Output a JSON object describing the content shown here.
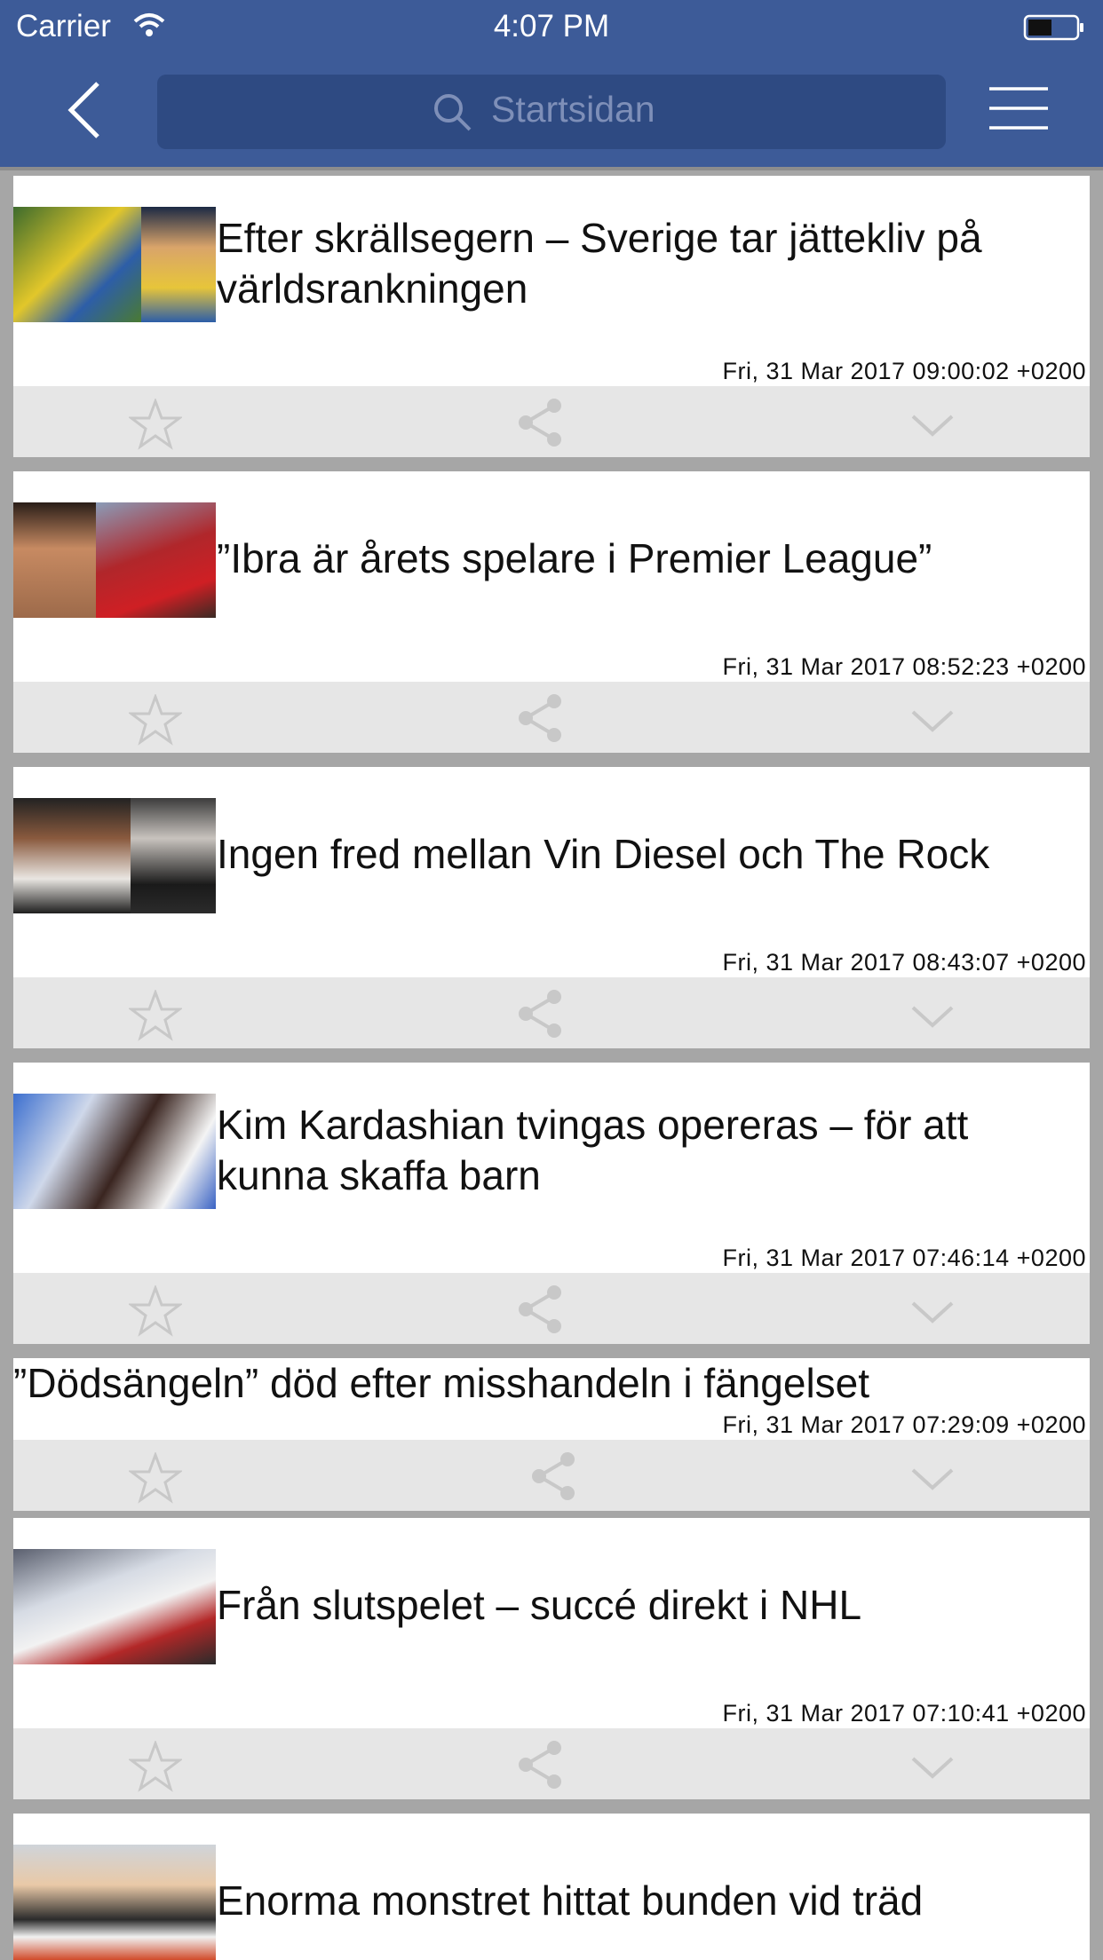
{
  "status_bar": {
    "carrier": "Carrier",
    "time": "4:07 PM",
    "icons": [
      "wifi-icon",
      "battery-icon"
    ]
  },
  "nav": {
    "back_icon": "chevron-left-icon",
    "search_placeholder": "Startsidan",
    "search_icon": "search-icon",
    "menu_icon": "hamburger-menu-icon"
  },
  "colors": {
    "header": "#3d5b98",
    "search_bg": "#2e4a82",
    "action_bar": "#e6e6e6",
    "page_bg": "#a6a6a6"
  },
  "articles": [
    {
      "title_line1": "Efter skrällsegern – Sverige tar jättekliv på",
      "title_line2": "världsrankningen",
      "date": "Fri, 31 Mar 2017 09:00:02 +0200",
      "has_image": true
    },
    {
      "title_line1": "”Ibra är årets spelare i Premier League”",
      "title_line2": "",
      "date": "Fri, 31 Mar 2017 08:52:23 +0200",
      "has_image": true
    },
    {
      "title_line1": "Ingen fred mellan Vin Diesel och The Rock",
      "title_line2": "",
      "date": "Fri, 31 Mar 2017 08:43:07 +0200",
      "has_image": true
    },
    {
      "title_line1": "Kim Kardashian tvingas opereras – för att",
      "title_line2": "kunna skaffa barn",
      "date": "Fri, 31 Mar 2017 07:46:14 +0200",
      "has_image": true
    },
    {
      "title_line1": "”Dödsängeln” död efter misshandeln i fängelset",
      "title_line2": "",
      "date": "Fri, 31 Mar 2017 07:29:09 +0200",
      "has_image": false
    },
    {
      "title_line1": "Från slutspelet – succé direkt i NHL",
      "title_line2": "",
      "date": "Fri, 31 Mar 2017 07:10:41 +0200",
      "has_image": true
    },
    {
      "title_line1": "Enorma monstret hittat bunden vid träd",
      "title_line2": "",
      "date": "",
      "has_image": true
    }
  ],
  "actions": {
    "favorite_icon": "star-icon",
    "share_icon": "share-icon",
    "expand_icon": "chevron-down-icon"
  }
}
